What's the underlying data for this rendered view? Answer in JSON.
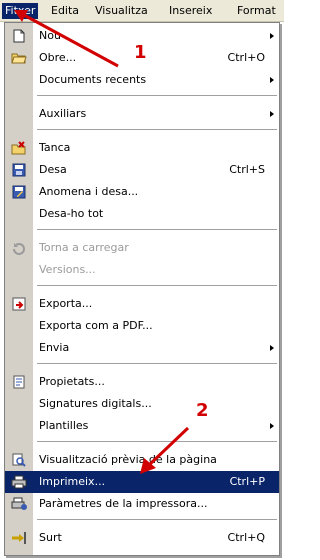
{
  "menubar": {
    "items": [
      {
        "label": "Fitxer",
        "active": true
      },
      {
        "label": "Edita"
      },
      {
        "label": "Visualitza"
      },
      {
        "label": "Insereix"
      },
      {
        "label": "Format"
      }
    ]
  },
  "menu": {
    "items": [
      {
        "label": "Nou",
        "shortcut": "",
        "submenu": true,
        "icon": "new-document-icon"
      },
      {
        "label": "Obre...",
        "shortcut": "Ctrl+O",
        "icon": "open-folder-icon"
      },
      {
        "label": "Documents recents",
        "shortcut": "",
        "submenu": true
      },
      {
        "label": "Auxiliars",
        "shortcut": "",
        "submenu": true
      },
      {
        "label": "Tanca",
        "shortcut": "",
        "icon": "close-document-icon"
      },
      {
        "label": "Desa",
        "shortcut": "Ctrl+S",
        "icon": "save-icon"
      },
      {
        "label": "Anomena i desa...",
        "shortcut": "",
        "icon": "save-as-icon"
      },
      {
        "label": "Desa-ho tot",
        "shortcut": ""
      },
      {
        "label": "Torna a carregar",
        "shortcut": "",
        "disabled": true,
        "icon": "reload-icon"
      },
      {
        "label": "Versions...",
        "shortcut": "",
        "disabled": true
      },
      {
        "label": "Exporta...",
        "shortcut": "",
        "icon": "export-icon"
      },
      {
        "label": "Exporta com a PDF...",
        "shortcut": ""
      },
      {
        "label": "Envia",
        "shortcut": "",
        "submenu": true
      },
      {
        "label": "Propietats...",
        "shortcut": "",
        "icon": "properties-icon"
      },
      {
        "label": "Signatures digitals...",
        "shortcut": ""
      },
      {
        "label": "Plantilles",
        "shortcut": "",
        "submenu": true
      },
      {
        "label": "Visualització prèvia de la pàgina",
        "shortcut": "",
        "icon": "print-preview-icon"
      },
      {
        "label": "Imprimeix...",
        "shortcut": "Ctrl+P",
        "highlighted": true,
        "icon": "printer-icon"
      },
      {
        "label": "Paràmetres de la impressora...",
        "shortcut": "",
        "icon": "printer-settings-icon"
      },
      {
        "label": "Surt",
        "shortcut": "Ctrl+Q",
        "icon": "exit-icon"
      }
    ]
  },
  "annotations": {
    "label_1": "1",
    "label_2": "2",
    "color": "#d20000"
  }
}
